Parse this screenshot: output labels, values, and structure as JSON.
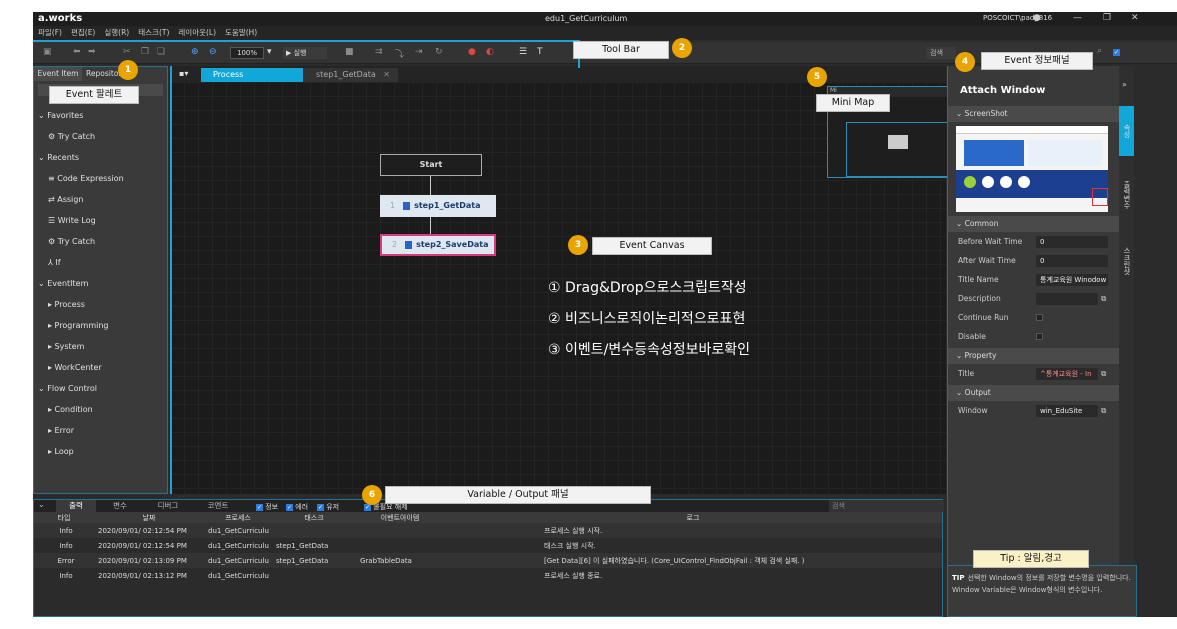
{
  "app": {
    "logo": "a.works",
    "title": "edu1_GetCurriculum",
    "user": "POSCOICT\\padp816",
    "win_controls": [
      "—",
      "❐",
      "✕"
    ]
  },
  "menu": [
    "파일(F)",
    "편집(E)",
    "실행(R)",
    "태스크(T)",
    "레이아웃(L)",
    "도움말(H)"
  ],
  "toolbar": {
    "zoom": "100%",
    "run_label": "▶ 실행",
    "search_label": "검색"
  },
  "left_panel": {
    "tabs": [
      "Event Item",
      "Repository"
    ],
    "tree": [
      {
        "label": "⌄ Favorites",
        "level": 0
      },
      {
        "label": "⚙ Try Catch",
        "level": 1
      },
      {
        "label": "⌄ Recents",
        "level": 0
      },
      {
        "label": "≡ Code Expression",
        "level": 1
      },
      {
        "label": "⇄ Assign",
        "level": 1
      },
      {
        "label": "☰ Write Log",
        "level": 1
      },
      {
        "label": "⚙ Try Catch",
        "level": 1
      },
      {
        "label": "⅄ If",
        "level": 1
      },
      {
        "label": "⌄ EventItem",
        "level": 0
      },
      {
        "label": "▸ Process",
        "level": 2
      },
      {
        "label": "▸ Programming",
        "level": 2
      },
      {
        "label": "▸ System",
        "level": 2
      },
      {
        "label": "▸ WorkCenter",
        "level": 2
      },
      {
        "label": "⌄ Flow Control",
        "level": 0
      },
      {
        "label": "▸ Condition",
        "level": 2
      },
      {
        "label": "▸ Error",
        "level": 2
      },
      {
        "label": "▸ Loop",
        "level": 2
      }
    ]
  },
  "canvas": {
    "tabs": {
      "active": "Process",
      "inactive": "step1_GetData",
      "close": "✕"
    },
    "nodes": {
      "start": "Start",
      "step1_num": "1",
      "step1": "step1_GetData",
      "step2_num": "2",
      "step2": "step2_SaveData"
    },
    "minimap_label": "Mi"
  },
  "features": [
    "① Drag&Drop으로스크립트작성",
    "② 비즈니스로직이논리적으로표현",
    "③ 이벤트/변수등속성정보바로확인"
  ],
  "right_panel": {
    "title": "Attach Window",
    "sections": {
      "screenshot": "⌄ ScreenShot",
      "common": "⌄ Common",
      "property": "⌄ Property",
      "output": "⌄ Output"
    },
    "common": {
      "before_wait_label": "Before Wait Time",
      "before_wait": "0",
      "after_wait_label": "After Wait Time",
      "after_wait": "0",
      "title_name_label": "Title Name",
      "title_name": "통계교육원 Winodow",
      "description_label": "Description",
      "description": "",
      "continue_run_label": "Continue Run",
      "disable_label": "Disable"
    },
    "property": {
      "title_label": "Title",
      "title": "^통계교육원 - In"
    },
    "output": {
      "window_label": "Window",
      "window": "win_EduSite"
    },
    "side_tabs": [
      "속성",
      "출력변수",
      "스크린샷"
    ]
  },
  "bottom_panel": {
    "tabs": [
      "출력",
      "변수",
      "디버그",
      "코멘트"
    ],
    "filters": [
      "정보",
      "에러",
      "유저",
      "",
      "불필요 해제"
    ],
    "search": "검색",
    "columns": [
      "타입",
      "날짜",
      "프로세스",
      "태스크",
      "이벤트아이템",
      "로그"
    ],
    "rows": [
      [
        "Info",
        "2020/09/01/ 02:12:54 PM",
        "du1_GetCurriculu",
        "",
        "",
        "프로세스 실행 시작."
      ],
      [
        "Info",
        "2020/09/01/ 02:12:54 PM",
        "du1_GetCurriculu",
        "step1_GetData",
        "",
        "태스크 실행 시작."
      ],
      [
        "Error",
        "2020/09/01/ 02:13:09 PM",
        "du1_GetCurriculu",
        "step1_GetData",
        "GrabTableData",
        "[Get Data][6] 이 실패하였습니다. (Core_UIControl_FindObjFail : 객체 검색 실패. )"
      ],
      [
        "Info",
        "2020/09/01/ 02:13:12 PM",
        "du1_GetCurriculu",
        "",
        "",
        "프로세스 실행 종료."
      ]
    ]
  },
  "tip": {
    "label": "TIP",
    "text": "선택한 Window의 정보를 저장할 변수명을 입력합니다. Window Variable은 Window형식의 변수입니다."
  },
  "callouts": {
    "toolbar": "Tool Bar",
    "toolbar_n": "2",
    "event_palette": "Event 팔레트",
    "event_palette_n": "1",
    "event_info": "Event 정보패널",
    "event_info_n": "4",
    "minimap": "Mini Map",
    "minimap_n": "5",
    "canvas": "Event Canvas",
    "canvas_n": "3",
    "varout": "Variable / Output 패널",
    "varout_n": "6",
    "tip": "Tip : 알림,경고"
  }
}
